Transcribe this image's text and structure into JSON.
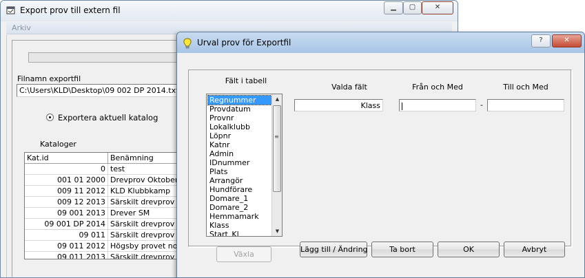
{
  "back_window": {
    "title": "Export prov till extern fil",
    "menu": [
      "Arkiv"
    ],
    "filename_label": "Filnamn exportfil",
    "filename_value": "C:\\Users\\KLD\\Desktop\\09 002 DP 2014.txt",
    "radio_label": "Exportera aktuell katalog",
    "catalogs_label": "Kataloger",
    "catalog_table": {
      "columns": [
        "Kat.id",
        "Benämning"
      ],
      "rows": [
        [
          "0",
          "test"
        ],
        [
          "001 01 2000",
          "Drevprov Oktober"
        ],
        [
          "009 11 2012",
          "KLD Klubbkamp"
        ],
        [
          "009 12 2013",
          "Särskilt drevprov Dec"
        ],
        [
          "09 001 2013",
          "Drever SM"
        ],
        [
          "09 001 DP 2014",
          "Särskilt drevprov Jan"
        ],
        [
          "09 011",
          "Särskilt drevprov"
        ],
        [
          "09 011 2012",
          "Högsby provet nover"
        ],
        [
          "09 011 2013",
          "Särskilt drevprov Jan"
        ]
      ]
    }
  },
  "dialog": {
    "title": "Urval prov för Exportfil",
    "help_label": "?",
    "close_label": "✕",
    "fields_header": "Fält i tabell",
    "fields": [
      "Regnummer",
      "Provdatum",
      "Provnr",
      "Lokalklubb",
      "Löpnr",
      "Katnr",
      "Admin",
      "IDnummer",
      "Plats",
      "Arrangör",
      "Hundförare",
      "Domare_1",
      "Domare_2",
      "Hemmamark",
      "Klass",
      "Start_Kl"
    ],
    "selected_index": 0,
    "headers": {
      "selected": "Valda fält",
      "from": "Från och Med",
      "to": "Till och Med"
    },
    "selected_field_value": "Klass",
    "from_value": "",
    "to_value": "",
    "dash": "-",
    "buttons": {
      "swap": "Växla",
      "add_change": "Lägg till / Ändring",
      "remove": "Ta bort",
      "ok": "OK",
      "cancel": "Avbryt"
    }
  }
}
